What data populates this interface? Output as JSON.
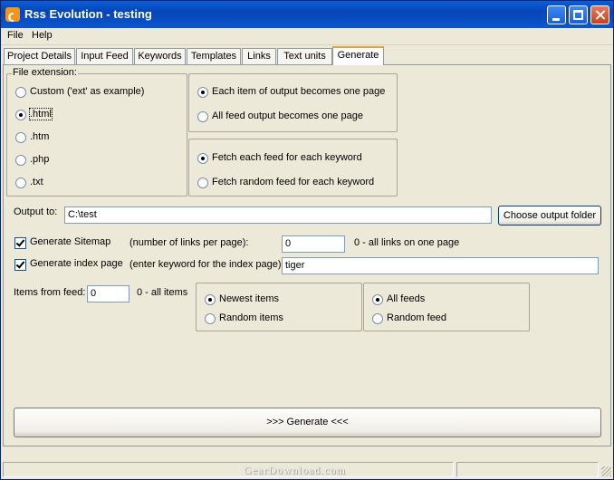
{
  "window": {
    "title": "Rss Evolution - testing"
  },
  "menu": [
    "File",
    "Help"
  ],
  "tabs": [
    "Project Details",
    "Input Feed",
    "Keywords",
    "Templates",
    "Links",
    "Text units",
    "Generate"
  ],
  "active_tab": "Generate",
  "file_extension": {
    "label": "File extension:",
    "options": [
      "Custom ('ext' as example)",
      ".html",
      ".htm",
      ".php",
      ".txt"
    ],
    "selected": ".html"
  },
  "output_mode": {
    "options": [
      "Each item of output becomes one page",
      "All feed output becomes one page"
    ],
    "selected": "Each item of output becomes one page"
  },
  "fetch_mode": {
    "options": [
      "Fetch each feed for each keyword",
      "Fetch random feed for each keyword"
    ],
    "selected": "Fetch each feed for each keyword"
  },
  "output": {
    "label": "Output to:",
    "value": "C:\\test",
    "button": "Choose output folder"
  },
  "sitemap": {
    "label": "Generate Sitemap",
    "checked": true,
    "hint": "(number of links per page):",
    "value": "0",
    "note": "0 - all links on one page"
  },
  "index_page": {
    "label": "Generate index page",
    "checked": true,
    "hint": "(enter keyword for the index page):",
    "value": "tiger"
  },
  "items_from_feed": {
    "label": "Items from feed:",
    "value": "0",
    "note": "0 - all items"
  },
  "item_order": {
    "options": [
      "Newest items",
      "Random items"
    ],
    "selected": "Newest items"
  },
  "feed_scope": {
    "options": [
      "All feeds",
      "Random feed"
    ],
    "selected": "All feeds"
  },
  "generate_button": ">>> Generate <<<",
  "watermark": "GearDownload.com",
  "colors": {
    "title_bar": "#0a5fd8",
    "window_bg": "#ece9d8",
    "tab_highlight": "#e8a33c",
    "close_button": "#c6401c"
  }
}
